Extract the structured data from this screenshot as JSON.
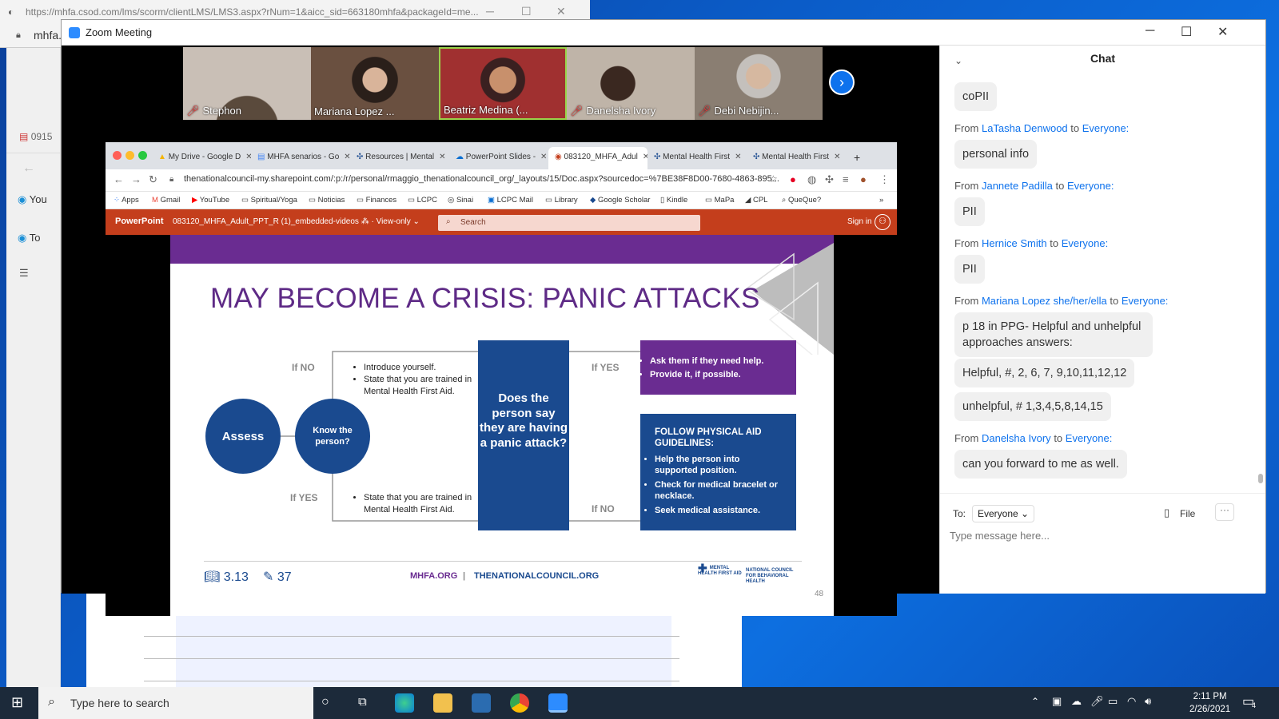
{
  "bg_browser": {
    "url": "https://mhfa.csod.com/lms/scorm/clientLMS/LMS3.aspx?rNum=1&aicc_sid=663180mhfa&packageId=me...",
    "tab_title": "mhfa.",
    "side_items": [
      "0915",
      "You",
      "To"
    ]
  },
  "zoom": {
    "title": "Zoom Meeting",
    "participants": [
      {
        "name": "Stephon",
        "muted": true,
        "color": "#c9bfb6"
      },
      {
        "name": "Mariana Lopez ...",
        "muted": false,
        "color": "#6a5040"
      },
      {
        "name": "Beatriz Medina (...",
        "muted": false,
        "color": "#a03030"
      },
      {
        "name": "Danelsha Ivory",
        "muted": true,
        "color": "#bfb4a8"
      },
      {
        "name": "Debi Nebijin...",
        "muted": true,
        "color": "#8a7e72"
      }
    ]
  },
  "shared": {
    "tabs": [
      "My Drive - Google D",
      "MHFA senarios - Go",
      "Resources | Mental",
      "PowerPoint Slides -",
      "083120_MHFA_Adul",
      "Mental Health First",
      "Mental Health First"
    ],
    "url": "thenationalcouncil-my.sharepoint.com/:p:/r/personal/rmaggio_thenationalcouncil_org/_layouts/15/Doc.aspx?sourcedoc=%7BE38F8D00-7680-4863-895...",
    "bookmarks": [
      "Apps",
      "Gmail",
      "YouTube",
      "Spiritual/Yoga",
      "Noticias",
      "Finances",
      "LCPC",
      "Sinai",
      "LCPC Mail",
      "Library",
      "Google Scholar",
      "Kindle",
      "MaPa",
      "CPL",
      "QueQue?"
    ],
    "pp_brand": "PowerPoint",
    "pp_doc": "083120_MHFA_Adult_PPT_R (1)_embedded-videos",
    "pp_mode": "View-only",
    "pp_search": "Search",
    "pp_signin": "Sign in"
  },
  "slide": {
    "title": "MAY BECOME A CRISIS: PANIC ATTACKS",
    "assess": "Assess",
    "know": "Know the person?",
    "if_no": "If NO",
    "if_yes": "If YES",
    "no_bullets": [
      "Introduce yourself.",
      "State that you are trained in Mental Health First Aid."
    ],
    "yes_bullets": [
      "State that you are trained in Mental Health First Aid."
    ],
    "question": "Does the person say they are having a panic attack?",
    "yes_box": [
      "Ask them if they need help.",
      "Provide it, if possible."
    ],
    "no_box_title": "FOLLOW PHYSICAL AID GUIDELINES:",
    "no_box": [
      "Help the person into supported position.",
      "Check for medical bracelet or necklace.",
      "Seek medical assistance."
    ],
    "ref_book": "3.13",
    "ref_pen": "37",
    "site1": "MHFA.ORG",
    "site2": "THENATIONALCOUNCIL.ORG",
    "page": "48",
    "logo1": "MENTAL HEALTH FIRST AID",
    "logo2": "NATIONAL COUNCIL FOR BEHAVIORAL HEALTH"
  },
  "chat": {
    "title": "Chat",
    "to_label": "To:",
    "to_value": "Everyone",
    "file_label": "File",
    "placeholder": "Type message here...",
    "from_word": "From",
    "to_word": "to",
    "audience": "Everyone:",
    "first_msg": "coPII",
    "messages": [
      {
        "from": "LaTasha Denwood",
        "texts": [
          "personal info"
        ]
      },
      {
        "from": "Jannete Padilla",
        "texts": [
          "PII"
        ]
      },
      {
        "from": "Hernice Smith",
        "texts": [
          "PII"
        ]
      },
      {
        "from": "Mariana Lopez she/her/ella",
        "texts": [
          "p 18 in PPG- Helpful and unhelpful approaches answers:",
          "Helpful, #, 2, 6, 7, 9,10,11,12,12",
          "unhelpful, # 1,3,4,5,8,14,15"
        ]
      },
      {
        "from": "Danelsha Ivory",
        "texts": [
          "can you forward to me as well."
        ]
      }
    ]
  },
  "taskbar": {
    "search": "Type here to search",
    "time": "2:11 PM",
    "date": "2/26/2021",
    "notif": "4"
  }
}
